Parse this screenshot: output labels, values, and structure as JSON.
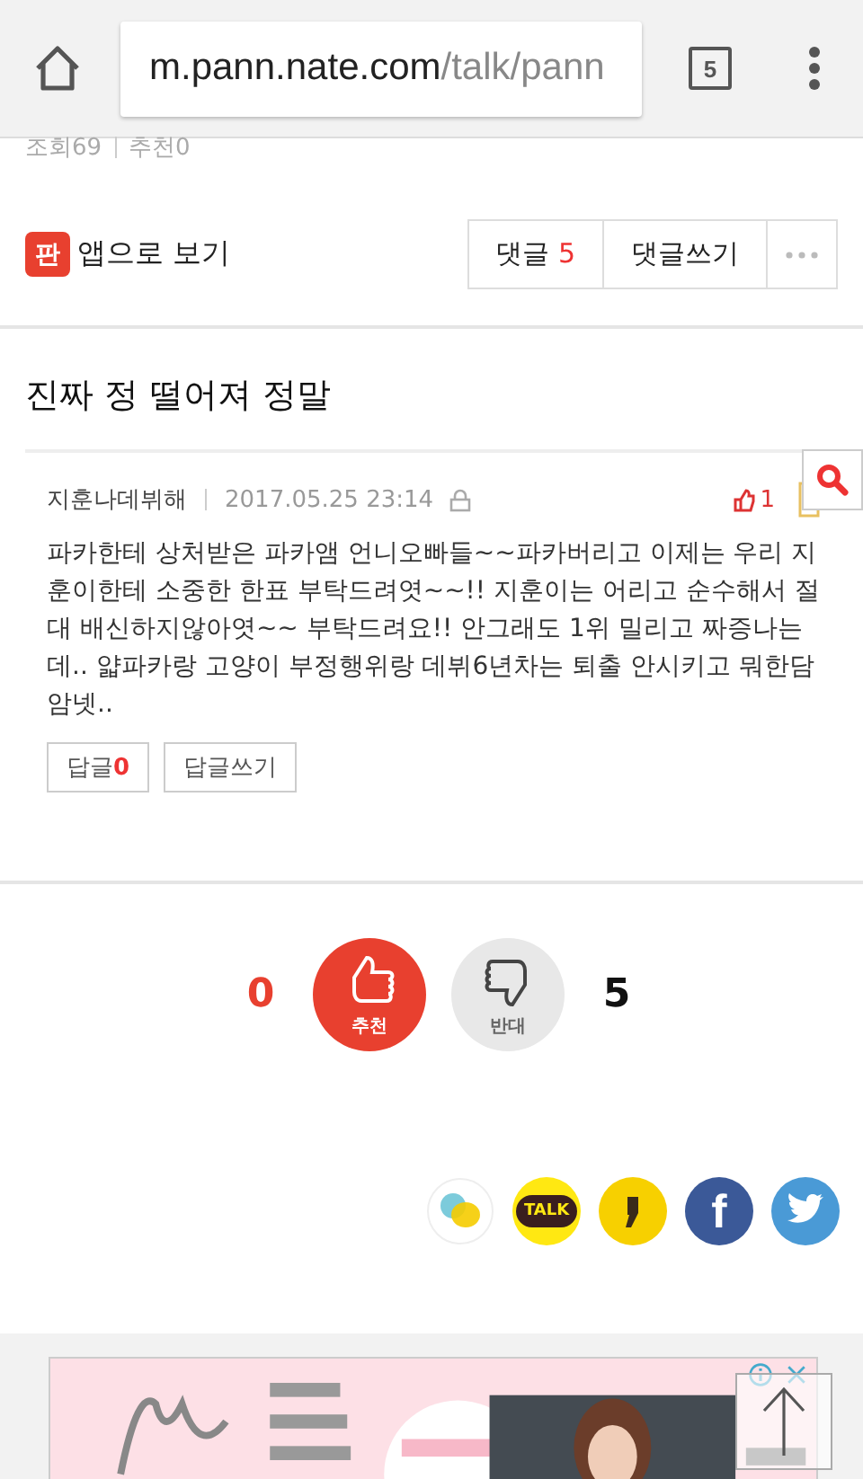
{
  "browser": {
    "url_host": "m.pann.nate.com",
    "url_path": "/talk/pann",
    "tab_count": "5"
  },
  "meta": {
    "views": "조회69",
    "recommends": "추천0"
  },
  "toolbar": {
    "app_link": "앱으로 보기",
    "app_badge": "판",
    "comments_label": "댓글",
    "comments_count": "5",
    "write_comment": "댓글쓰기"
  },
  "post_title": "진짜 정 떨어져 정말",
  "comment": {
    "author": "지훈나데뷔해",
    "date": "2017.05.25 23:14",
    "likes": "1",
    "text": "파카한테 상처받은 파카앰 언니오빠들~~파카버리고 이제는 우리 지훈이한테 소중한 한표 부탁드려엿~~!! 지훈이는 어리고 순수해서 절대 배신하지않아엿~~ 부탁드려요!! 안그래도 1위 밀리고 짜증나는데.. 얇파카랑 고양이 부정행위랑 데뷔6년차는 퇴출 안시키고 뭐한담암넷..",
    "reply_label": "답글",
    "reply_count": "0",
    "write_reply": "답글쓰기"
  },
  "vote": {
    "up_count": "0",
    "up_label": "추천",
    "down_label": "반대",
    "down_count": "5"
  },
  "share": {
    "talk_label": "TALK",
    "facebook_label": "f"
  }
}
